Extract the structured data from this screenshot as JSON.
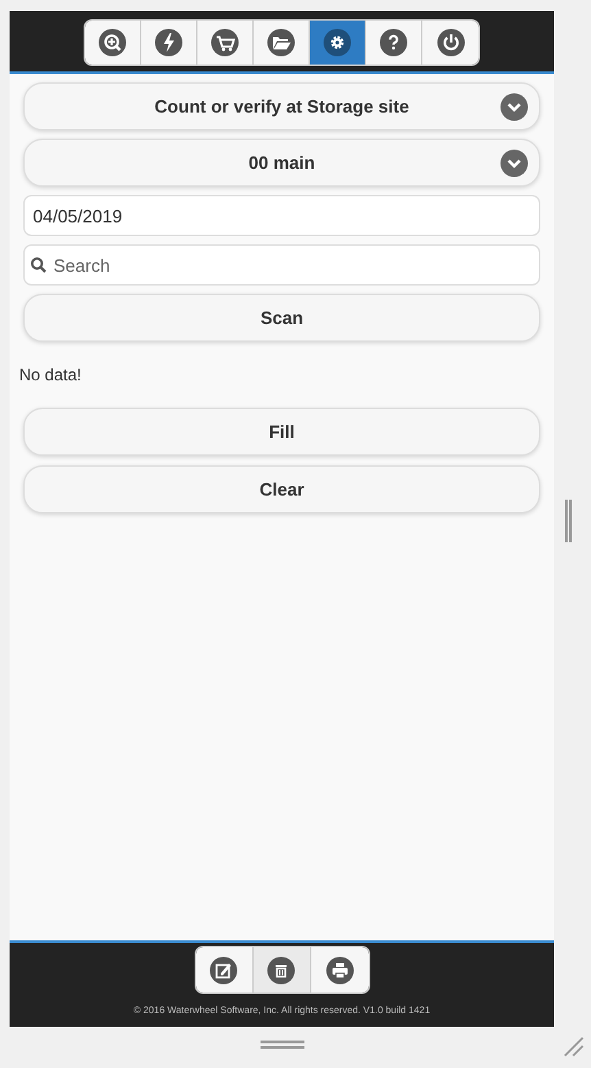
{
  "top_tabs": [
    {
      "selected": false
    },
    {
      "selected": false
    },
    {
      "selected": false
    },
    {
      "selected": false
    },
    {
      "selected": true
    },
    {
      "selected": false
    },
    {
      "selected": false
    }
  ],
  "selects": [
    {
      "value": "Count or verify at Storage site"
    },
    {
      "value": "00 main"
    }
  ],
  "date_field": {
    "value": "04/05/2019"
  },
  "search": {
    "placeholder": "Search"
  },
  "scan_button": "Scan",
  "message": "No data!",
  "buttons": [
    "Fill",
    "Clear"
  ],
  "footer": {
    "copyright": "© 2016 Waterwheel Software, Inc. All rights reserved. V1.0 build 1421"
  }
}
